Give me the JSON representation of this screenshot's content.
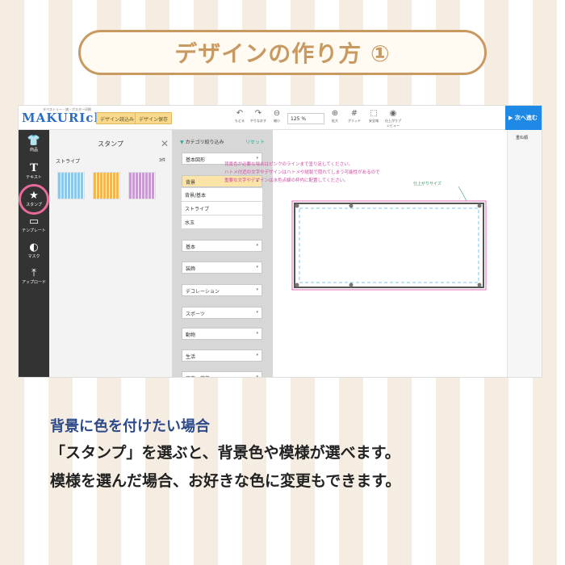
{
  "header": {
    "title": "デザインの作り方 ①"
  },
  "app": {
    "logo": "MAKURIchi",
    "logo_sub": "タペストリー・旗・ポスター印刷",
    "top_buttons": [
      "デザイン読込み",
      "デザイン保存"
    ],
    "tools": [
      {
        "icon": "undo-icon",
        "label": "もどる"
      },
      {
        "icon": "redo-icon",
        "label": "やりなおす"
      },
      {
        "icon": "zoom-out-icon",
        "label": "縮小"
      },
      {
        "icon": "zoom-in-icon",
        "label": "拡大"
      },
      {
        "icon": "grid-icon",
        "label": "グリッド"
      },
      {
        "icon": "safe-area-icon",
        "label": "安全域"
      },
      {
        "icon": "preview-icon",
        "label": "仕上がりプレビュー"
      }
    ],
    "zoom_value": "125 %",
    "next_button": "▶ 次へ進む",
    "right_col_title": "重ね順",
    "leftbar": [
      {
        "icon": "shirt-icon",
        "label": "商品"
      },
      {
        "icon": "text-icon",
        "label": "テキスト"
      },
      {
        "icon": "stamp-icon",
        "label": "スタンプ"
      },
      {
        "icon": "template-icon",
        "label": "テンプレート"
      },
      {
        "icon": "mask-icon",
        "label": "マスク"
      },
      {
        "icon": "upload-icon",
        "label": "アップロード"
      }
    ],
    "panel": {
      "title": "スタンプ",
      "subtitle": "ストライプ",
      "count": "3件"
    },
    "swatches": [
      "#8cc6ea",
      "#f7b552",
      "#c99ad2"
    ],
    "filter": {
      "heading": "カテゴリ絞り込み",
      "reset": "リセット",
      "dropdown_top": "基本図形",
      "open_category": "背景",
      "options": [
        "背景/基本",
        "ストライプ",
        "水玉"
      ],
      "categories": [
        "基本",
        "装飾",
        "デコレーション",
        "スポーツ",
        "動物",
        "生活",
        "音楽・芸能"
      ]
    },
    "notes": [
      "背景色が必要な場合はピンクのラインまで塗り足してください。",
      "ハトメ付近の文字やデザインはハトメや縫製で隠れてしまう可能性があるので",
      "重要な文字やデザインは水色点線の枠内に配置してください。"
    ],
    "cut_label": "仕上がりサイズ"
  },
  "description": {
    "line1": "背景に色を付けたい場合",
    "line2": "「スタンプ」を選ぶと、背景色や模様が選べます。",
    "line3": "模様を選んだ場合、お好きな色に変更もできます。"
  }
}
